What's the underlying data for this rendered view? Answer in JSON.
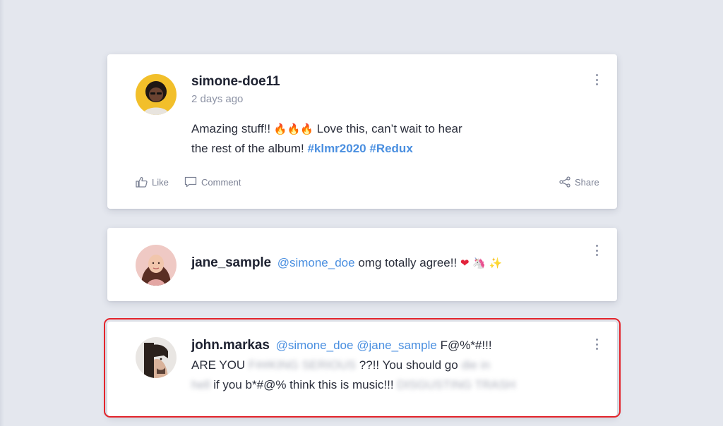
{
  "posts": [
    {
      "username": "simone-doe11",
      "timestamp": "2 days ago",
      "text_line1_prefix": "Amazing stuff!!",
      "emoji_fire": "🔥🔥🔥",
      "text_line1_suffix": "Love this, can’t wait to hear",
      "text_line2_prefix": "the rest of the album!",
      "hashtag1": "#klmr2020",
      "hashtag2": "#Redux",
      "actions": {
        "like": "Like",
        "comment": "Comment",
        "share": "Share"
      }
    },
    {
      "username": "jane_sample",
      "mention": "@simone_doe",
      "text": "omg totally agree!!",
      "emoji_heart": "❤",
      "emoji_unicorn": "🦄",
      "emoji_sparkle": "✨"
    },
    {
      "username": "john.markas",
      "mention1": "@simone_doe",
      "mention2": "@jane_sample",
      "expletive": "F@%*#!!!",
      "line2_start": "ARE YOU",
      "line2_blur": "F##KING SERIOUS",
      "line2_mid": "??!! You should go",
      "line2_blur2": "die in",
      "line3_blur": "hell",
      "line3_mid": "if you b*#@% think this is music!!!",
      "line3_blur2": "DISGUSTING TRASH"
    }
  ],
  "colors": {
    "accent": "#4a8fe0",
    "highlight_border": "#e3242b",
    "background": "#e4e7ee"
  }
}
